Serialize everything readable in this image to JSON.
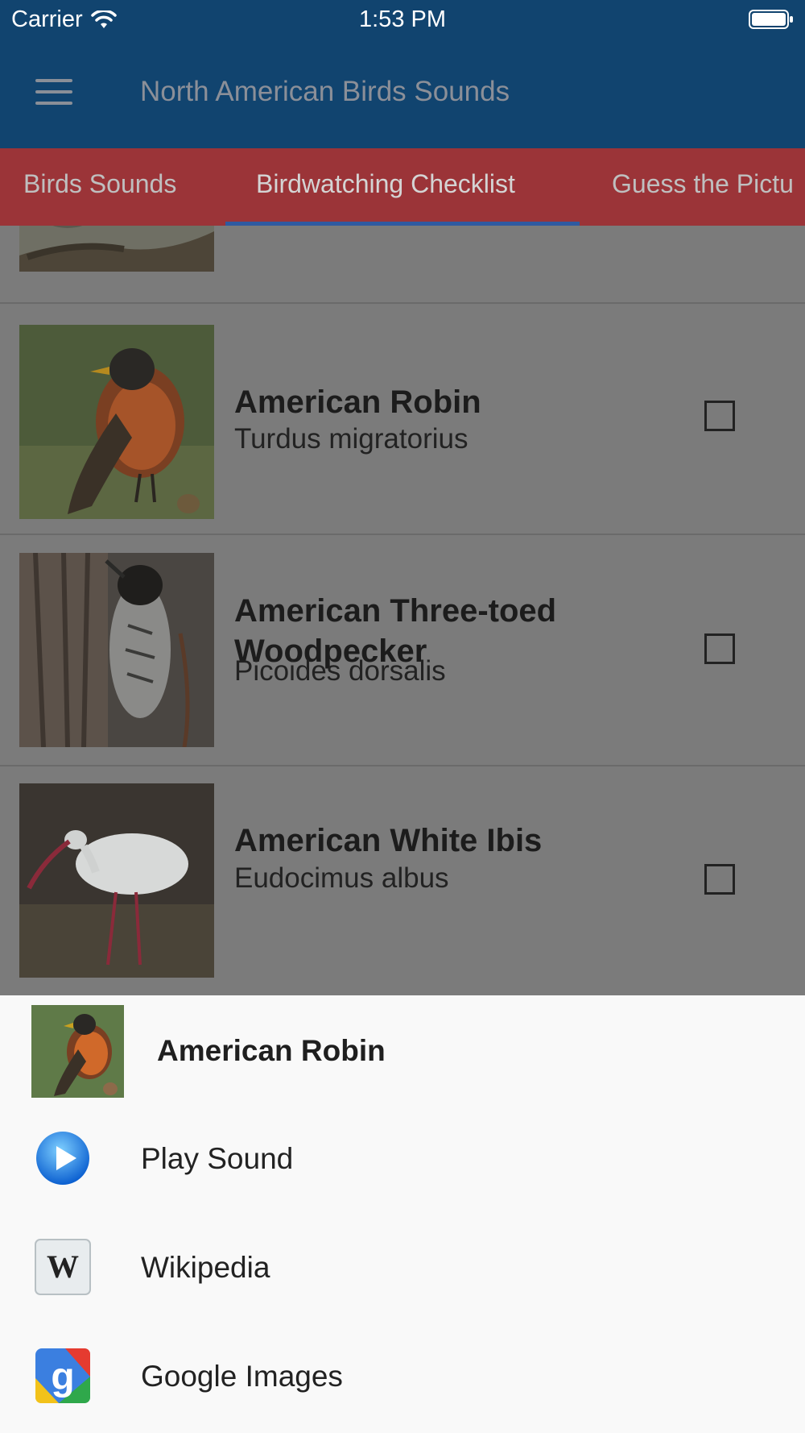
{
  "status_bar": {
    "carrier": "Carrier",
    "time": "1:53 PM"
  },
  "app_bar": {
    "title": "North American Birds Sounds"
  },
  "tabs": [
    {
      "label": "Birds Sounds"
    },
    {
      "label": "Birdwatching Checklist"
    },
    {
      "label": "Guess the Pictu"
    }
  ],
  "list": {
    "items": [
      {
        "name": "American Robin",
        "scientific": "Turdus migratorius"
      },
      {
        "name": "American Three-toed Woodpecker",
        "scientific": "Picoides dorsalis"
      },
      {
        "name": "American White Ibis",
        "scientific": "Eudocimus albus"
      }
    ]
  },
  "sheet": {
    "title": "American Robin",
    "actions": [
      {
        "label": "Play Sound",
        "icon": "play-icon"
      },
      {
        "label": "Wikipedia",
        "icon": "wikipedia-icon"
      },
      {
        "label": "Google Images",
        "icon": "google-icon"
      }
    ]
  }
}
